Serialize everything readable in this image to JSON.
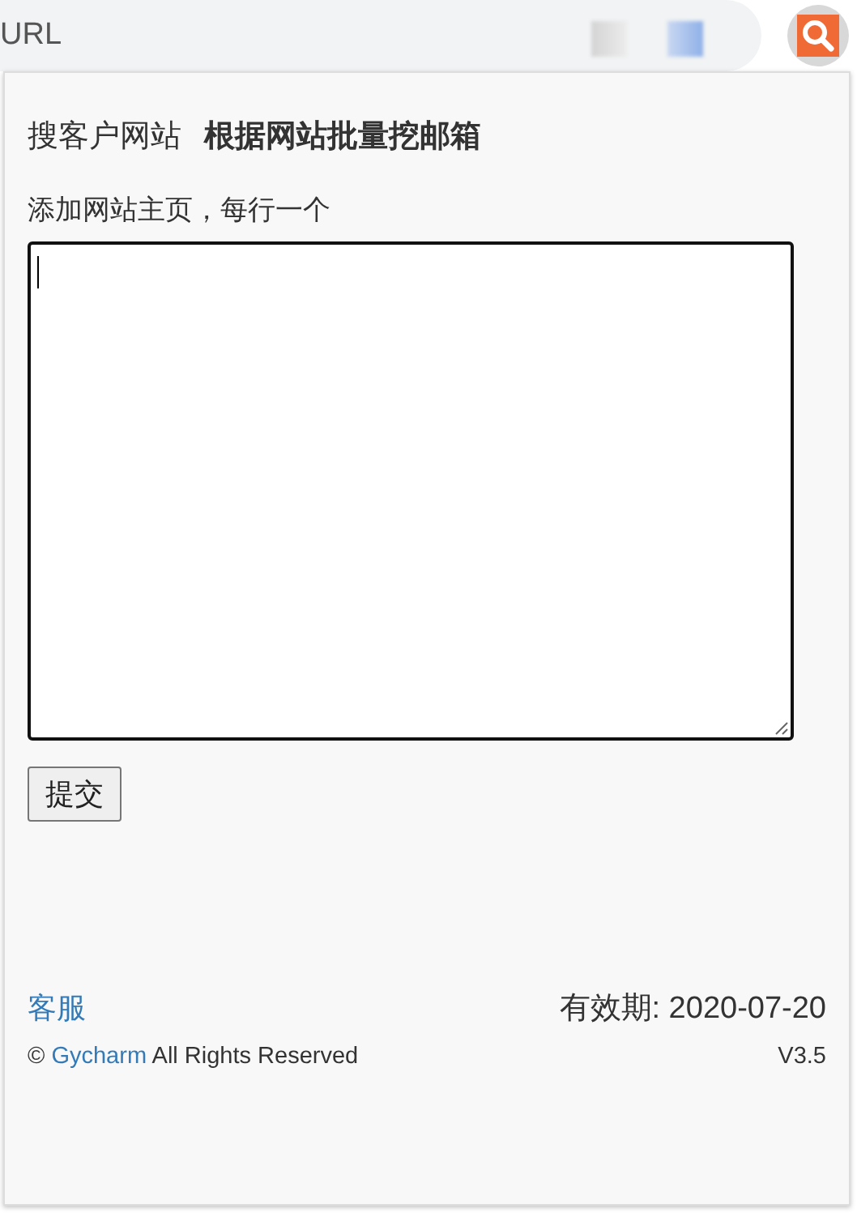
{
  "browser_bar": {
    "address_text": "URL"
  },
  "popup": {
    "title": "搜客户网站",
    "subtitle": "根据网站批量挖邮箱",
    "field_label": "添加网站主页，每行一个",
    "submit": "提交",
    "footer": {
      "support_link": "客服",
      "expiry": "有效期: 2020-07-20",
      "copyright_symbol": "©",
      "company_link": "Gycharm",
      "rights": "All Rights Reserved",
      "version": "V3.5"
    }
  }
}
